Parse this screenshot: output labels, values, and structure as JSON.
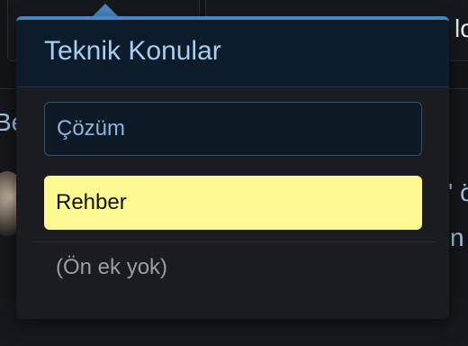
{
  "background": {
    "title_fragment": "Be",
    "right_fragment_1": "lo",
    "right_fragment_2": "' ö",
    "right_fragment_3": "n"
  },
  "prefix_menu": {
    "title": "Teknik Konular",
    "options": [
      {
        "label": "Çözüm",
        "state": "outlined"
      },
      {
        "label": "Rehber",
        "state": "selected"
      }
    ],
    "none_option": "(Ön ek yok)",
    "colors": {
      "accent": "#4a86c0",
      "header_bg": "#0c1c2b",
      "selected_bg": "#fff991",
      "outline": "#2c5173"
    }
  }
}
